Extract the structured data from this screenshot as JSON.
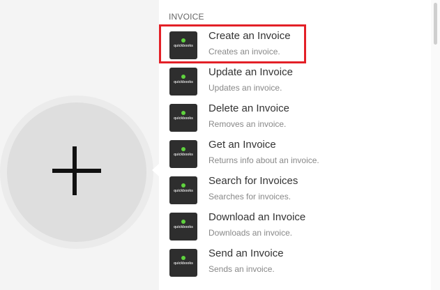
{
  "section": {
    "title": "INVOICE"
  },
  "app": {
    "logo_text": "quickbooks"
  },
  "items": [
    {
      "title": "Create an Invoice",
      "desc": "Creates an invoice."
    },
    {
      "title": "Update an Invoice",
      "desc": "Updates an invoice."
    },
    {
      "title": "Delete an Invoice",
      "desc": "Removes an invoice."
    },
    {
      "title": "Get an Invoice",
      "desc": "Returns info about an invoice."
    },
    {
      "title": "Search for Invoices",
      "desc": "Searches for invoices."
    },
    {
      "title": "Download an Invoice",
      "desc": "Downloads an invoice."
    },
    {
      "title": "Send an Invoice",
      "desc": "Sends an invoice."
    }
  ],
  "colors": {
    "highlight": "#e32027",
    "logo_bg": "#2e2e2e",
    "logo_dot": "#5fd33e"
  }
}
